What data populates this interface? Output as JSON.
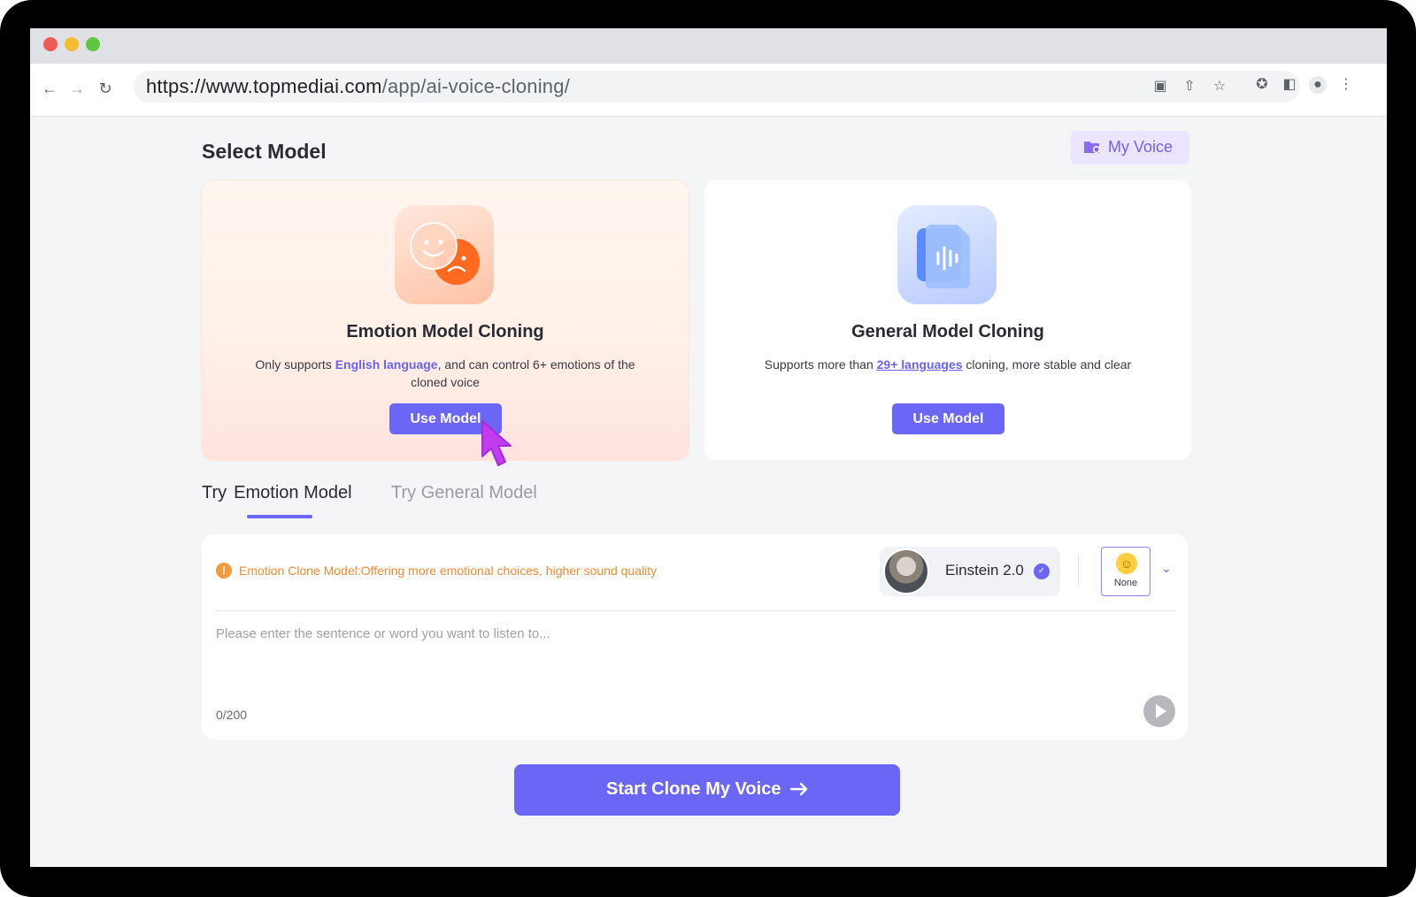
{
  "browser": {
    "url_main": "https://www.topmediai.com",
    "url_path": "/app/ai-voice-cloning/"
  },
  "page": {
    "select_title": "Select Model",
    "my_voice_label": "My Voice"
  },
  "cards": [
    {
      "title": "Emotion Model Cloning",
      "desc_before": "Only supports ",
      "desc_link": "English language",
      "desc_after": ", and can control 6+ emotions of the cloned voice",
      "button_label": "Use Model"
    },
    {
      "title": "General Model Cloning",
      "desc_before": "Supports more than ",
      "desc_link": "29+ languages",
      "desc_after": " cloning, more stable and clear",
      "button_label": "Use Model"
    }
  ],
  "tabs": {
    "active_prefix": "Try",
    "active_label": "Emotion Model",
    "inactive_label": "Try General Model"
  },
  "panel": {
    "notice": "Emotion Clone Model:Offering more emotional choices, higher sound quality",
    "voice_name": "Einstein 2.0",
    "emotion_label": "None",
    "placeholder": "Please enter the sentence or word you want to listen to...",
    "counter": "0/200"
  },
  "cta": {
    "label": "Start Clone My Voice"
  },
  "colors": {
    "accent": "#6b66f5",
    "warning": "#f08a33",
    "my_voice_bg": "#ebe5ff"
  }
}
